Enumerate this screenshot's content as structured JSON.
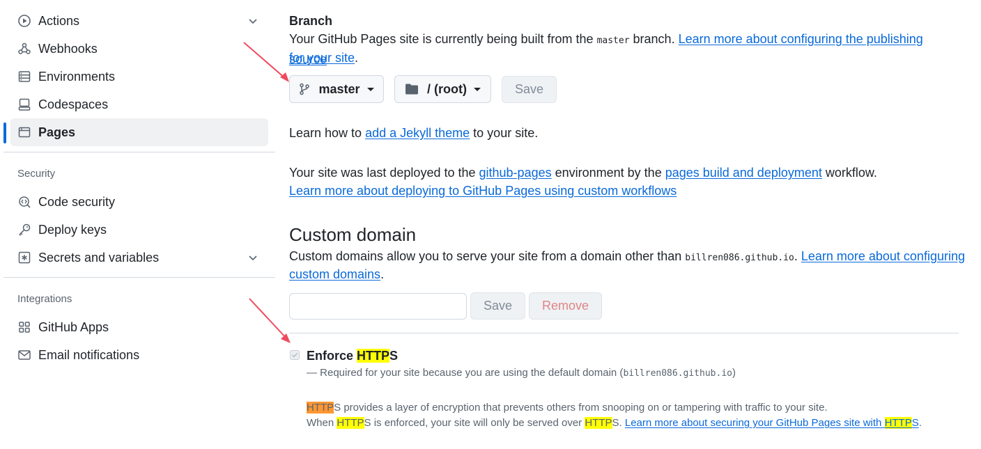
{
  "sidebar": {
    "items": [
      {
        "label": "Actions",
        "icon": "play-circle-icon",
        "has_chevron": true
      },
      {
        "label": "Webhooks",
        "icon": "webhook-icon",
        "has_chevron": false
      },
      {
        "label": "Environments",
        "icon": "server-icon",
        "has_chevron": false
      },
      {
        "label": "Codespaces",
        "icon": "codespaces-icon",
        "has_chevron": false
      },
      {
        "label": "Pages",
        "icon": "browser-icon",
        "has_chevron": false,
        "active": true
      }
    ],
    "security_heading": "Security",
    "security_items": [
      {
        "label": "Code security",
        "icon": "codescan-icon"
      },
      {
        "label": "Deploy keys",
        "icon": "key-icon"
      },
      {
        "label": "Secrets and variables",
        "icon": "asterisk-icon",
        "has_chevron": true
      }
    ],
    "integrations_heading": "Integrations",
    "integrations_items": [
      {
        "label": "GitHub Apps",
        "icon": "apps-icon"
      },
      {
        "label": "Email notifications",
        "icon": "mail-icon"
      }
    ]
  },
  "branch": {
    "heading": "Branch",
    "desc_prefix": "Your GitHub Pages site is currently being built from the ",
    "branch_code": "master",
    "desc_suffix": " branch. ",
    "learn_link_1": "Learn more about configuring the publishing source",
    "learn_link_2": "for your site",
    "period": ".",
    "branch_select": "master",
    "folder_select": "/ (root)",
    "save_label": "Save"
  },
  "jekyll": {
    "prefix": "Learn how to ",
    "link": "add a Jekyll theme",
    "suffix": " to your site."
  },
  "deploy": {
    "prefix": "Your site was last deployed to the ",
    "env_link": "github-pages",
    "middle": " environment by the ",
    "workflow_link": "pages build and deployment",
    "suffix": " workflow.",
    "learn_link": "Learn more about deploying to GitHub Pages using custom workflows"
  },
  "custom_domain": {
    "heading": "Custom domain",
    "desc_prefix": "Custom domains allow you to serve your site from a domain other than ",
    "domain_code": "billren086.github.io",
    "desc_mid": ". ",
    "learn_link_1": "Learn more about configuring",
    "learn_link_2": "custom domains",
    "period": ".",
    "input_value": "",
    "save_label": "Save",
    "remove_label": "Remove"
  },
  "https": {
    "label_pre": "Enforce ",
    "label_hl": "HTTP",
    "label_post": "S",
    "checked": true,
    "required_prefix": "— Required for your site because you are using the default domain (",
    "required_domain": "billren086.github.io",
    "required_suffix": ")",
    "info_hl": "HTTP",
    "info_1_rest": "S provides a layer of encryption that prevents others from snooping on or tampering with traffic to your site.",
    "info_2_a": "When ",
    "info_2_hl1": "HTTP",
    "info_2_b": "S is enforced, your site will only be served over ",
    "info_2_hl2": "HTTP",
    "info_2_c": "S. ",
    "info_2_link_pre": "Learn more about securing your GitHub Pages site with ",
    "info_2_link_hl": "HTTP",
    "info_2_link_post": "S",
    "info_2_end": "."
  },
  "colors": {
    "accent": "#0969da",
    "highlight_yellow": "#ffff00",
    "highlight_orange": "#ff9632",
    "annotation_arrow": "#f04a5e"
  }
}
